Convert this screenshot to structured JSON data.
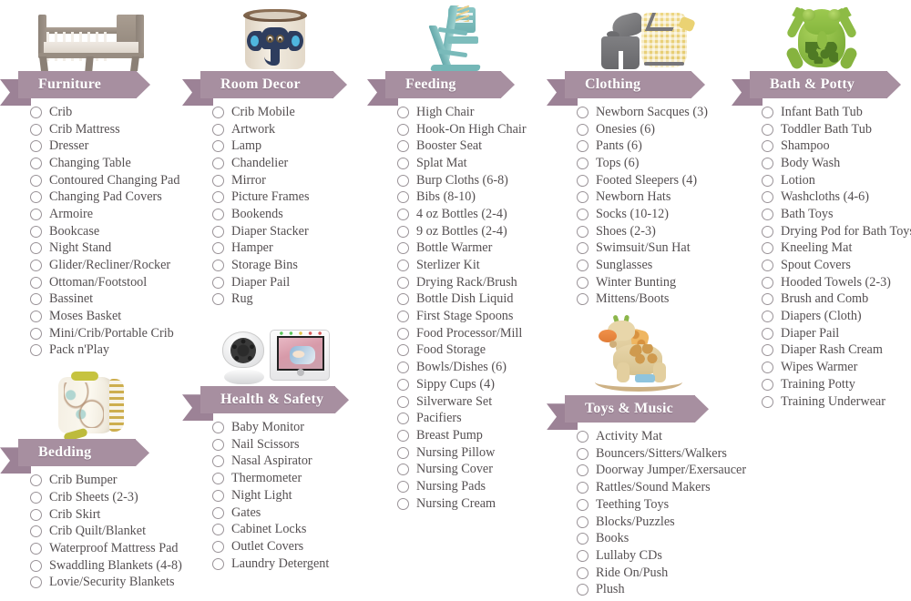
{
  "theme": {
    "banner_fill": "#a78fa0",
    "banner_shadow": "#9c8296",
    "banner_text": "#ffffff",
    "item_text": "#555052",
    "checkbox_border": "#9a9398",
    "page_background": "#ffffff"
  },
  "columns": [
    {
      "sections": [
        {
          "title": "Furniture",
          "image": "crib-illustration",
          "items": [
            "Crib",
            "Crib Mattress",
            "Dresser",
            "Changing Table",
            "Contoured Changing Pad",
            "Changing Pad Covers",
            "Armoire",
            "Bookcase",
            "Night Stand",
            "Glider/Recliner/Rocker",
            "Ottoman/Footstool",
            "Bassinet",
            "Moses Basket",
            "Mini/Crib/Portable Crib",
            "Pack n'Play"
          ]
        },
        {
          "title": "Bedding",
          "image": "crib-bumper-illustration",
          "items": [
            "Crib Bumper",
            "Crib Sheets (2-3)",
            "Crib Skirt",
            "Crib Quilt/Blanket",
            "Waterproof Mattress Pad",
            "Swaddling Blankets (4-8)",
            "Lovie/Security Blankets"
          ]
        }
      ]
    },
    {
      "sections": [
        {
          "title": "Room Decor",
          "image": "elephant-storage-bin-illustration",
          "items": [
            "Crib Mobile",
            "Artwork",
            "Lamp",
            "Chandelier",
            "Mirror",
            "Picture Frames",
            "Bookends",
            "Diaper Stacker",
            "Hamper",
            "Storage Bins",
            "Diaper Pail",
            "Rug"
          ]
        },
        {
          "title": "Health & Safety",
          "image": "baby-monitor-illustration",
          "items": [
            "Baby Monitor",
            "Nail Scissors",
            "Nasal Aspirator",
            "Thermometer",
            "Night Light",
            "Gates",
            "Cabinet Locks",
            "Outlet Covers",
            "Laundry Detergent"
          ]
        }
      ]
    },
    {
      "sections": [
        {
          "title": "Feeding",
          "image": "high-chair-illustration",
          "items": [
            "High Chair",
            "Hook-On High Chair",
            "Booster Seat",
            "Splat Mat",
            "Burp Cloths (6-8)",
            "Bibs (8-10)",
            "4 oz Bottles (2-4)",
            "9 oz Bottles (2-4)",
            "Bottle Warmer",
            "Sterlizer Kit",
            "Drying Rack/Brush",
            "Bottle Dish Liquid",
            "First Stage Spoons",
            "Food Processor/Mill",
            "Food Storage",
            "Bowls/Dishes (6)",
            "Sippy Cups (4)",
            "Silverware Set",
            "Pacifiers",
            "Breast Pump",
            "Nursing Pillow",
            "Nursing Cover",
            "Nursing Pads",
            "Nursing Cream"
          ]
        }
      ]
    },
    {
      "sections": [
        {
          "title": "Clothing",
          "image": "baby-outfit-illustration",
          "items": [
            "Newborn Sacques (3)",
            "Onesies (6)",
            "Pants (6)",
            "Tops (6)",
            "Footed Sleepers (4)",
            "Newborn Hats",
            "Socks (10-12)",
            "Shoes (2-3)",
            "Swimsuit/Sun Hat",
            "Sunglasses",
            "Winter Bunting",
            "Mittens/Boots"
          ]
        },
        {
          "title": "Toys & Music",
          "image": "giraffe-rocker-illustration",
          "items": [
            "Activity Mat",
            "Bouncers/Sitters/Walkers",
            "Doorway Jumper/Exersaucer",
            "Rattles/Sound Makers",
            "Teething Toys",
            "Blocks/Puzzles",
            "Books",
            "Lullaby CDs",
            "Ride On/Push",
            "Plush"
          ]
        }
      ]
    },
    {
      "sections": [
        {
          "title": "Bath & Potty",
          "image": "frog-bath-toy-illustration",
          "items": [
            "Infant Bath Tub",
            "Toddler Bath Tub",
            "Shampoo",
            "Body Wash",
            "Lotion",
            "Washcloths (4-6)",
            "Bath Toys",
            "Drying Pod for Bath Toys",
            "Kneeling Mat",
            "Spout Covers",
            "Hooded Towels (2-3)",
            "Brush and Comb",
            "Diapers (Cloth)",
            "Diaper Pail",
            "Diaper Rash Cream",
            "Wipes Warmer",
            "Training Potty",
            "Training Underwear"
          ]
        }
      ]
    }
  ]
}
